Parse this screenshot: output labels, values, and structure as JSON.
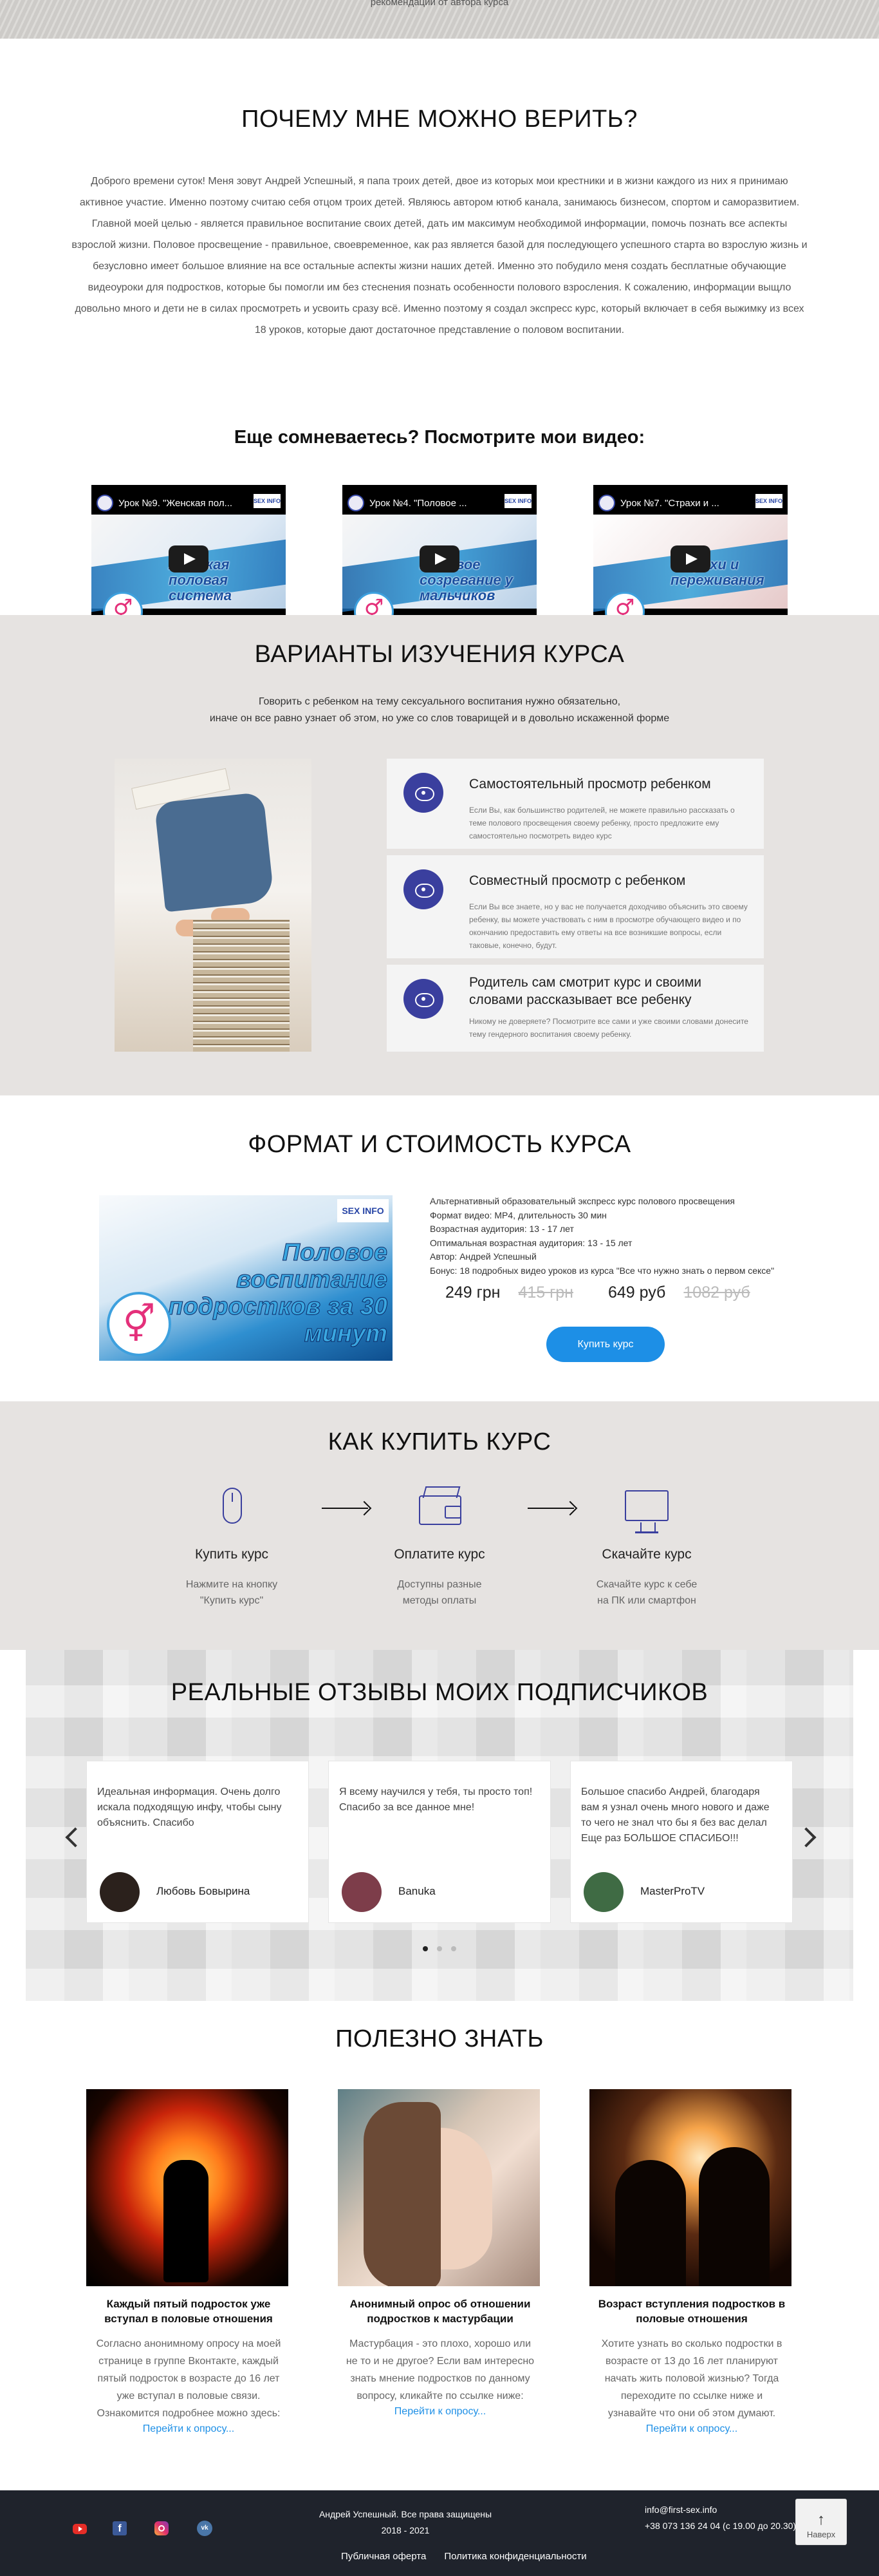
{
  "top_strip": {
    "caption": "рекомендации от автора курса"
  },
  "trust": {
    "title": "ПОЧЕМУ МНЕ МОЖНО ВЕРИТЬ?",
    "text": "Доброго времени суток! Меня зовут Андрей Успешный, я папа троих детей, двое из которых мои крестники и в жизни каждого из них я принимаю активное участие. Именно поэтому считаю себя отцом троих детей. Являюсь автором ютюб канала, занимаюсь бизнесом, спортом и саморазвитием. Главной моей целью - является правильное воспитание своих детей, дать им максимум необходимой информации, помочь познать все аспекты взрослой жизни. Половое просвещение - правильное, своевременное, как раз является базой для последующего успешного старта во взрослую жизнь и безусловно имеет большое влияние на все остальные аспекты жизни наших детей. Именно это побудило меня создать бесплатные обучающие видеоуроки для подростков, которые бы помогли им без стеснения познать особенности полового взросления. К сожалению, информации выщло довольно много и дети не в силах просмотреть и усвоить сразу всё. Именно поэтому я создал экспресс курс, который включает в себя выжимку из всех 18 уроков, которые дают достаточное представление о половом воспитании.",
    "videos_heading": "Еще сомневаетесь? Посмотрите мои видео:",
    "videos": [
      {
        "title": "Урок №9. \"Женская пол...",
        "overlay": "Женская половая система"
      },
      {
        "title": "Урок №4. \"Половое ...",
        "overlay": "Половое созревание у мальчиков"
      },
      {
        "title": "Урок №7. \"Страхи и ...",
        "overlay": "Страхи и переживания"
      }
    ],
    "video_logo": "SEX INFO"
  },
  "options": {
    "title": "ВАРИАНТЫ ИЗУЧЕНИЯ КУРСА",
    "lead_line1": "Говорить с ребенком на тему сексуального воспитания нужно обязательно,",
    "lead_line2": "иначе он все равно узнает об этом, но уже со слов товарищей и в довольно искаженной форме",
    "cards": [
      {
        "title": "Самостоятельный просмотр ребенком",
        "desc": "Если Вы, как большинство родителей, не можете правильно рассказать о теме полового просвещения своему ребенку, просто предложите ему самостоятельно посмотреть видео курс"
      },
      {
        "title": "Совместный просмотр с ребенком",
        "desc": "Если Вы все знаете, но у вас не получается доходчиво объяснить это своему ребенку, вы можете участвовать с ним в просмотре обучающего видео и по окончанию предоставить ему ответы на все возникшие вопросы, если таковые, конечно, будут."
      },
      {
        "title": "Родитель сам смотрит курс и своими словами рассказывает все ребенку",
        "desc": "Никому не доверяете? Посмотрите все сами и уже своими словами донесите тему гендерного воспитания своему ребенку."
      }
    ]
  },
  "pricing": {
    "title": "ФОРМАТ И СТОИМОСТЬ КУРСА",
    "banner_text": "Половое воспитание подростков за 30 минут",
    "banner_logo": "SEX INFO",
    "desc_lines": [
      "Альтернативный образовательный экспресс курс полового просвещения",
      "Формат видео: MP4, длительность 30 мин",
      "Возрастная аудитория: 13 - 17 лет",
      "Оптимальная возрастная аудитория: 13 - 15 лет",
      "Автор: Андрей Успешный",
      "Бонус: 18 подробных видео уроков из курса \"Все что нужно знать о первом сексе\""
    ],
    "price_uah": "249 грн",
    "old_price_uah": "415 грн",
    "price_rub": "649 руб",
    "old_price_rub": "1082 руб",
    "buy_label": "Купить курс"
  },
  "how": {
    "title": "КАК КУПИТЬ КУРС",
    "steps": [
      {
        "title": "Купить курс",
        "desc_line1": "Нажмите на кнопку",
        "desc_line2": "\"Купить курс\"",
        "icon": "mouse-icon"
      },
      {
        "title": "Оплатите курс",
        "desc_line1": "Доступны разные",
        "desc_line2": "методы оплаты",
        "icon": "wallet-icon"
      },
      {
        "title": "Скачайте курс",
        "desc_line1": "Скачайте курс к себе",
        "desc_line2": "на ПК или смартфон",
        "icon": "computer-icon"
      }
    ]
  },
  "reviews": {
    "title": "РЕАЛЬНЫЕ ОТЗЫВЫ МОИХ ПОДПИСЧИКОВ",
    "items": [
      {
        "text": "Идеальная информация. Очень долго искала подходящую инфу, чтобы сыну объяснить. Спасибо",
        "name": "Любовь Бовырина"
      },
      {
        "text": "Я всему научился у тебя, ты просто топ! Спасибо за все данное мне!",
        "name": "Banuka"
      },
      {
        "text": "Большое спасибо Андрей, благодаря вам я узнал очень много нового и даже то чего не знал что бы я без вас делал Еще раз БОЛЬШОЕ СПАСИБО!!!",
        "name": "MasterProTV"
      }
    ],
    "active_slide": 1,
    "slide_count": 3
  },
  "articles": {
    "title": "ПОЛЕЗНО ЗНАТЬ",
    "items": [
      {
        "title": "Каждый пятый подросток уже вступал в половые отношения",
        "desc": "Согласно анонимному опросу на моей странице в группе Вконтакте, каждый пятый подросток в возрасте до 16 лет уже вступал в половые связи. Ознакомится подробнее можно здесь:",
        "link": "Перейти к опросу..."
      },
      {
        "title": "Анонимный опрос об отношении подростков к мастурбации",
        "desc": "Мастурбация - это плохо, хорошо или не то и не другое? Если вам интересно знать мнение подростков по данному вопросу, кликайте по ссылке ниже:",
        "link": "Перейти к опросу..."
      },
      {
        "title": "Возраст вступления подростков в половые отношения",
        "desc": "Хотите узнать во сколько подростки в возрасте от 13 до 16 лет планируют начать жить половой жизнью? Тогда переходите по ссылке ниже и узнавайте что они об этом думают.",
        "link": "Перейти к опросу..."
      }
    ]
  },
  "footer": {
    "copyright": "Андрей Успешный. Все права защищены",
    "years": "2018 - 2021",
    "offer_link": "Публичная оферта",
    "privacy_link": "Политика конфиденциальности",
    "email": "info@first-sex.info",
    "phone": "+38 073 136 24 04 (с 19.00 до 20.30)",
    "socials": [
      "youtube-icon",
      "facebook-icon",
      "instagram-icon",
      "vk-icon"
    ]
  },
  "back_to_top": {
    "label": "Наверх"
  }
}
